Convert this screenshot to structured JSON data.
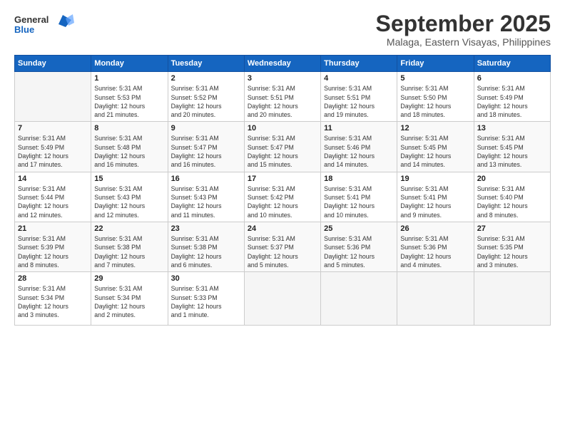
{
  "logo": {
    "line1": "General",
    "line2": "Blue"
  },
  "header": {
    "month": "September 2025",
    "location": "Malaga, Eastern Visayas, Philippines"
  },
  "weekdays": [
    "Sunday",
    "Monday",
    "Tuesday",
    "Wednesday",
    "Thursday",
    "Friday",
    "Saturday"
  ],
  "weeks": [
    [
      {
        "day": "",
        "info": ""
      },
      {
        "day": "1",
        "info": "Sunrise: 5:31 AM\nSunset: 5:53 PM\nDaylight: 12 hours\nand 21 minutes."
      },
      {
        "day": "2",
        "info": "Sunrise: 5:31 AM\nSunset: 5:52 PM\nDaylight: 12 hours\nand 20 minutes."
      },
      {
        "day": "3",
        "info": "Sunrise: 5:31 AM\nSunset: 5:51 PM\nDaylight: 12 hours\nand 20 minutes."
      },
      {
        "day": "4",
        "info": "Sunrise: 5:31 AM\nSunset: 5:51 PM\nDaylight: 12 hours\nand 19 minutes."
      },
      {
        "day": "5",
        "info": "Sunrise: 5:31 AM\nSunset: 5:50 PM\nDaylight: 12 hours\nand 18 minutes."
      },
      {
        "day": "6",
        "info": "Sunrise: 5:31 AM\nSunset: 5:49 PM\nDaylight: 12 hours\nand 18 minutes."
      }
    ],
    [
      {
        "day": "7",
        "info": "Sunrise: 5:31 AM\nSunset: 5:49 PM\nDaylight: 12 hours\nand 17 minutes."
      },
      {
        "day": "8",
        "info": "Sunrise: 5:31 AM\nSunset: 5:48 PM\nDaylight: 12 hours\nand 16 minutes."
      },
      {
        "day": "9",
        "info": "Sunrise: 5:31 AM\nSunset: 5:47 PM\nDaylight: 12 hours\nand 16 minutes."
      },
      {
        "day": "10",
        "info": "Sunrise: 5:31 AM\nSunset: 5:47 PM\nDaylight: 12 hours\nand 15 minutes."
      },
      {
        "day": "11",
        "info": "Sunrise: 5:31 AM\nSunset: 5:46 PM\nDaylight: 12 hours\nand 14 minutes."
      },
      {
        "day": "12",
        "info": "Sunrise: 5:31 AM\nSunset: 5:45 PM\nDaylight: 12 hours\nand 14 minutes."
      },
      {
        "day": "13",
        "info": "Sunrise: 5:31 AM\nSunset: 5:45 PM\nDaylight: 12 hours\nand 13 minutes."
      }
    ],
    [
      {
        "day": "14",
        "info": "Sunrise: 5:31 AM\nSunset: 5:44 PM\nDaylight: 12 hours\nand 12 minutes."
      },
      {
        "day": "15",
        "info": "Sunrise: 5:31 AM\nSunset: 5:43 PM\nDaylight: 12 hours\nand 12 minutes."
      },
      {
        "day": "16",
        "info": "Sunrise: 5:31 AM\nSunset: 5:43 PM\nDaylight: 12 hours\nand 11 minutes."
      },
      {
        "day": "17",
        "info": "Sunrise: 5:31 AM\nSunset: 5:42 PM\nDaylight: 12 hours\nand 10 minutes."
      },
      {
        "day": "18",
        "info": "Sunrise: 5:31 AM\nSunset: 5:41 PM\nDaylight: 12 hours\nand 10 minutes."
      },
      {
        "day": "19",
        "info": "Sunrise: 5:31 AM\nSunset: 5:41 PM\nDaylight: 12 hours\nand 9 minutes."
      },
      {
        "day": "20",
        "info": "Sunrise: 5:31 AM\nSunset: 5:40 PM\nDaylight: 12 hours\nand 8 minutes."
      }
    ],
    [
      {
        "day": "21",
        "info": "Sunrise: 5:31 AM\nSunset: 5:39 PM\nDaylight: 12 hours\nand 8 minutes."
      },
      {
        "day": "22",
        "info": "Sunrise: 5:31 AM\nSunset: 5:38 PM\nDaylight: 12 hours\nand 7 minutes."
      },
      {
        "day": "23",
        "info": "Sunrise: 5:31 AM\nSunset: 5:38 PM\nDaylight: 12 hours\nand 6 minutes."
      },
      {
        "day": "24",
        "info": "Sunrise: 5:31 AM\nSunset: 5:37 PM\nDaylight: 12 hours\nand 5 minutes."
      },
      {
        "day": "25",
        "info": "Sunrise: 5:31 AM\nSunset: 5:36 PM\nDaylight: 12 hours\nand 5 minutes."
      },
      {
        "day": "26",
        "info": "Sunrise: 5:31 AM\nSunset: 5:36 PM\nDaylight: 12 hours\nand 4 minutes."
      },
      {
        "day": "27",
        "info": "Sunrise: 5:31 AM\nSunset: 5:35 PM\nDaylight: 12 hours\nand 3 minutes."
      }
    ],
    [
      {
        "day": "28",
        "info": "Sunrise: 5:31 AM\nSunset: 5:34 PM\nDaylight: 12 hours\nand 3 minutes."
      },
      {
        "day": "29",
        "info": "Sunrise: 5:31 AM\nSunset: 5:34 PM\nDaylight: 12 hours\nand 2 minutes."
      },
      {
        "day": "30",
        "info": "Sunrise: 5:31 AM\nSunset: 5:33 PM\nDaylight: 12 hours\nand 1 minute."
      },
      {
        "day": "",
        "info": ""
      },
      {
        "day": "",
        "info": ""
      },
      {
        "day": "",
        "info": ""
      },
      {
        "day": "",
        "info": ""
      }
    ]
  ]
}
